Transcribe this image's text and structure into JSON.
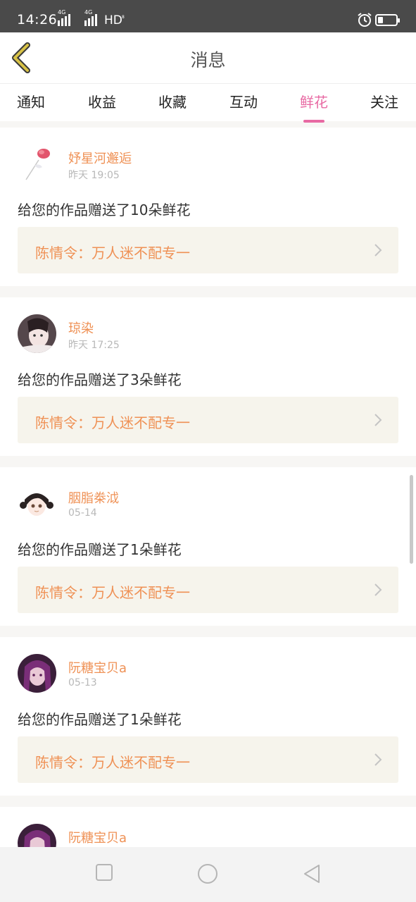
{
  "status_bar": {
    "time": "14:26",
    "network_1": "4G",
    "network_2": "4G",
    "hd": "HD",
    "hd_small": "8"
  },
  "header": {
    "title": "消息",
    "back_icon": "chevron-left-icon"
  },
  "tabs": [
    {
      "label": "通知"
    },
    {
      "label": "收益"
    },
    {
      "label": "收藏"
    },
    {
      "label": "互动"
    },
    {
      "label": "鲜花",
      "active": true
    },
    {
      "label": "关注"
    }
  ],
  "messages": [
    {
      "name": "妤星河邂逅",
      "date": "昨天 19:05",
      "text": "给您的作品赠送了10朵鲜花",
      "work": "陈情令：万人迷不配专一"
    },
    {
      "name": "琼染",
      "date": "昨天 17:25",
      "text": "给您的作品赠送了3朵鲜花",
      "work": "陈情令：万人迷不配专一"
    },
    {
      "name": "胭脂桊泧",
      "date": "05-14",
      "text": "给您的作品赠送了1朵鲜花",
      "work": "陈情令：万人迷不配专一"
    },
    {
      "name": "阮糖宝贝a",
      "date": "05-13",
      "text": "给您的作品赠送了1朵鲜花",
      "work": "陈情令：万人迷不配专一"
    },
    {
      "name": "阮糖宝贝a"
    }
  ],
  "colors": {
    "accent": "#e86aa3",
    "name": "#ef9155",
    "card_bg": "#f6f4ec",
    "back_icon": "#d8c247"
  }
}
